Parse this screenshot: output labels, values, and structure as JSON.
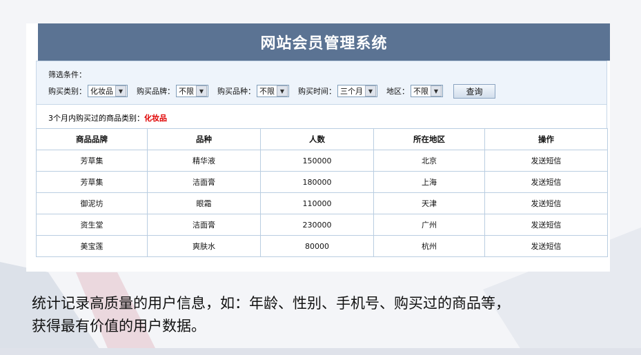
{
  "app": {
    "title": "网站会员管理系统"
  },
  "filter": {
    "heading": "筛选条件：",
    "fields": [
      {
        "label": "购买类别：",
        "value": "化妆品"
      },
      {
        "label": "购买品牌：",
        "value": "不限"
      },
      {
        "label": "购买品种：",
        "value": "不限"
      },
      {
        "label": "购买时间：",
        "value": "三个月"
      },
      {
        "label": "地区：",
        "value": "不限"
      }
    ],
    "query_label": "查询"
  },
  "summary": {
    "label": "3个月内购买过的商品类别：",
    "value": "化妆品"
  },
  "table": {
    "headers": [
      "商品品牌",
      "品种",
      "人数",
      "所在地区",
      "操作"
    ],
    "rows": [
      [
        "芳草集",
        "精华液",
        "150000",
        "北京",
        "发送短信"
      ],
      [
        "芳草集",
        "洁面膏",
        "180000",
        "上海",
        "发送短信"
      ],
      [
        "御泥坊",
        "眼霜",
        "110000",
        "天津",
        "发送短信"
      ],
      [
        "资生堂",
        "洁面膏",
        "230000",
        "广州",
        "发送短信"
      ],
      [
        "美宝莲",
        "爽肤水",
        "80000",
        "杭州",
        "发送短信"
      ]
    ]
  },
  "caption": {
    "line1": "统计记录高质量的用户信息，如：年龄、性别、手机号、购买过的商品等，",
    "line2": "获得最有价值的用户数据。"
  },
  "colors": {
    "title_bar": "#5b7393",
    "highlight": "#e00000",
    "filter_bg": "#eef4fb"
  }
}
